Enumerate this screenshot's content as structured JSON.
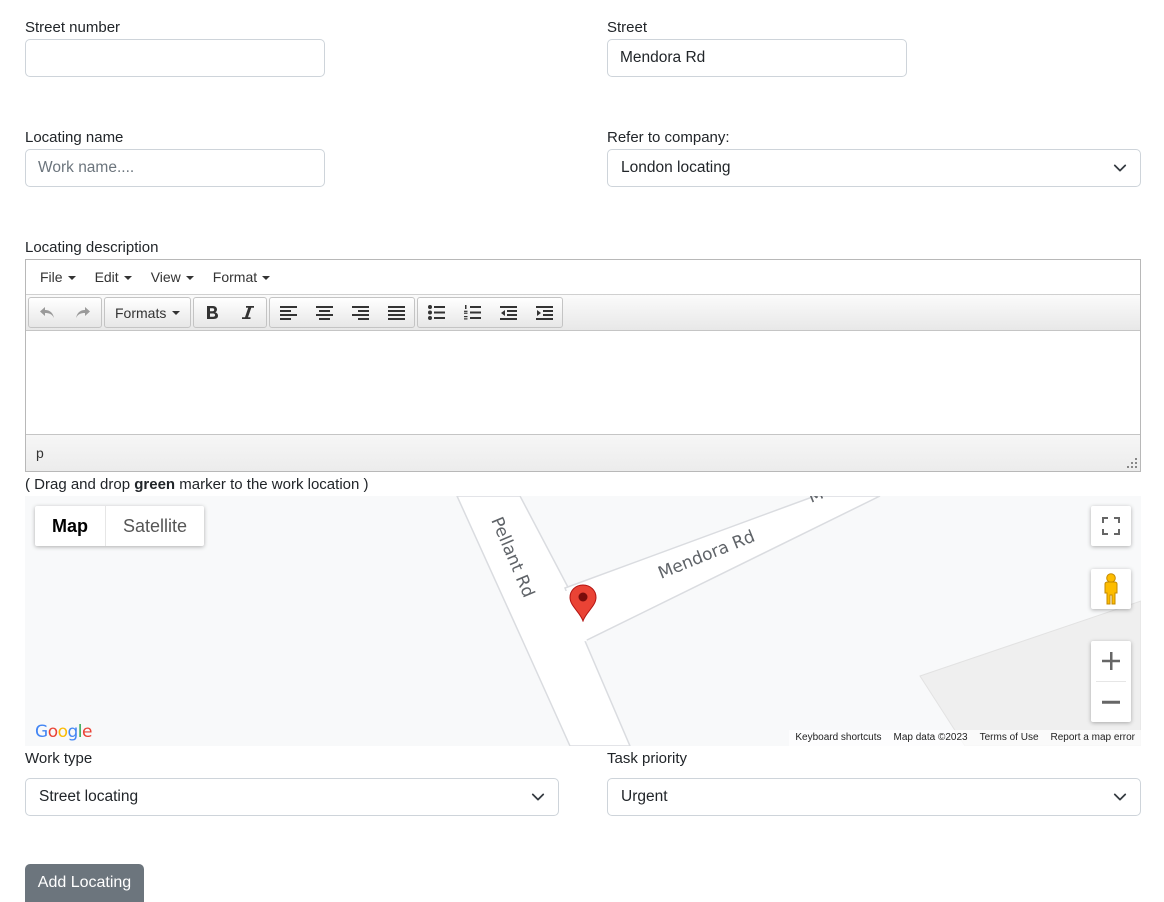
{
  "street_number": {
    "label": "Street number",
    "value": "",
    "placeholder": ""
  },
  "street": {
    "label": "Street",
    "value": "Mendora Rd"
  },
  "locating_name": {
    "label": "Locating name",
    "value": "",
    "placeholder": "Work name...."
  },
  "refer_company": {
    "label": "Refer to company:",
    "selected": "London locating"
  },
  "description": {
    "label": "Locating description",
    "menu": {
      "file": "File",
      "edit": "Edit",
      "view": "View",
      "format": "Format"
    },
    "formats_label": "Formats",
    "status_path": "p"
  },
  "map_hint": {
    "prefix": "( Drag and drop ",
    "bold": "green",
    "suffix": " marker to the work location )"
  },
  "map": {
    "type_map": "Map",
    "type_satellite": "Satellite",
    "road_pellant": "Pellant Rd",
    "road_mendora": "Mendora Rd",
    "road_partial": "M",
    "attribution": {
      "shortcuts": "Keyboard shortcuts",
      "data": "Map data ©2023",
      "terms": "Terms of Use",
      "report": "Report a map error"
    },
    "logo_letters": [
      "G",
      "o",
      "o",
      "g",
      "l",
      "e"
    ],
    "logo_colors": [
      "#4285F4",
      "#EA4335",
      "#FBBC05",
      "#4285F4",
      "#34A853",
      "#EA4335"
    ]
  },
  "work_type": {
    "label": "Work type",
    "selected": "Street locating"
  },
  "task_priority": {
    "label": "Task priority",
    "selected": "Urgent"
  },
  "submit": {
    "label": "Add Locating"
  }
}
